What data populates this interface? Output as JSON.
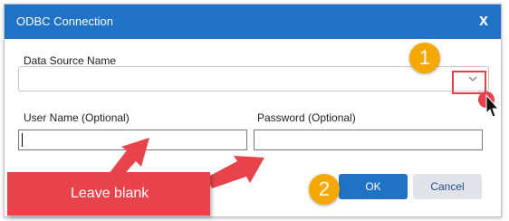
{
  "dialog": {
    "title": "ODBC Connection",
    "close_glyph": "x"
  },
  "form": {
    "dsn_label": "Data Source Name",
    "dsn_value": "",
    "user_label": "User Name (Optional)",
    "user_value": "",
    "password_label": "Password (Optional)",
    "password_value": ""
  },
  "buttons": {
    "ok_label": "OK",
    "cancel_label": "Cancel"
  },
  "annotations": {
    "step1": "1",
    "step2": "2",
    "callout_text": "Leave blank"
  },
  "colors": {
    "titlebar": "#1f72c6",
    "primary_button": "#1f72c6",
    "annotation_red": "#e8434b",
    "badge_orange": "#f5a800"
  },
  "icons": {
    "dropdown": "chevron-down-icon",
    "cursor": "mouse-pointer-icon"
  }
}
